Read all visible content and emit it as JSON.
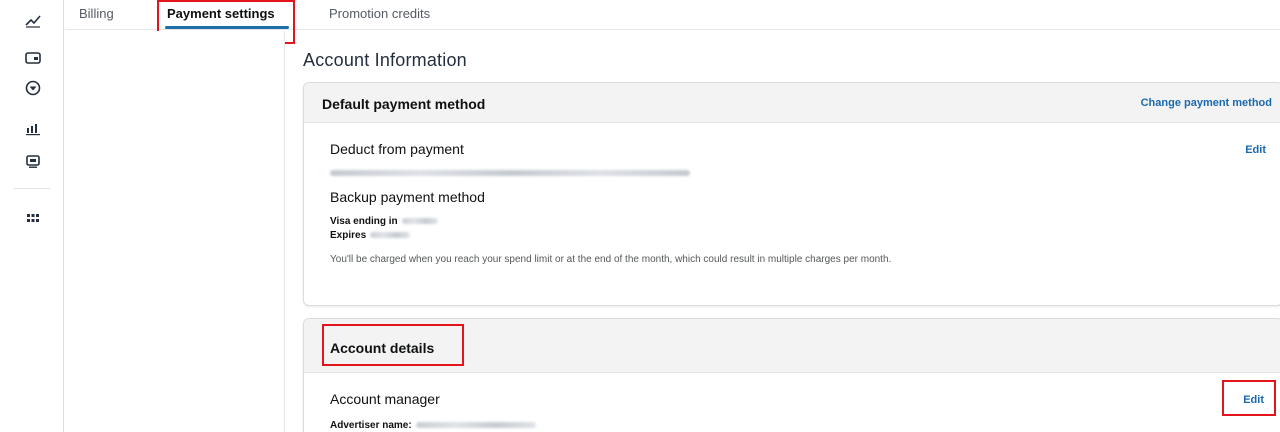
{
  "tabs": [
    {
      "label": "Billing"
    },
    {
      "label": "Payment settings"
    },
    {
      "label": "Promotion credits"
    }
  ],
  "main": {
    "title": "Account Information"
  },
  "default_payment": {
    "header": "Default payment method",
    "change_link": "Change payment method",
    "deduct_title": "Deduct from payment",
    "deduct_edit": "Edit",
    "backup_title": "Backup payment method",
    "visa_label": "Visa ending in",
    "expires_label": "Expires",
    "note": "You'll be charged when you reach your spend limit or at the end of the month, which could result in multiple charges per month."
  },
  "account_details": {
    "header": "Account details",
    "manager_title": "Account manager",
    "edit": "Edit",
    "advertiser_label": "Advertiser name:"
  },
  "colors": {
    "accent": "#1a69b0",
    "tab_underline": "#1d6fa8",
    "highlight": "#e3141b"
  },
  "icons": [
    "trend-icon",
    "wallet-icon",
    "shield-icon",
    "bar-chart-icon",
    "media-icon",
    "apps-grid-icon"
  ]
}
